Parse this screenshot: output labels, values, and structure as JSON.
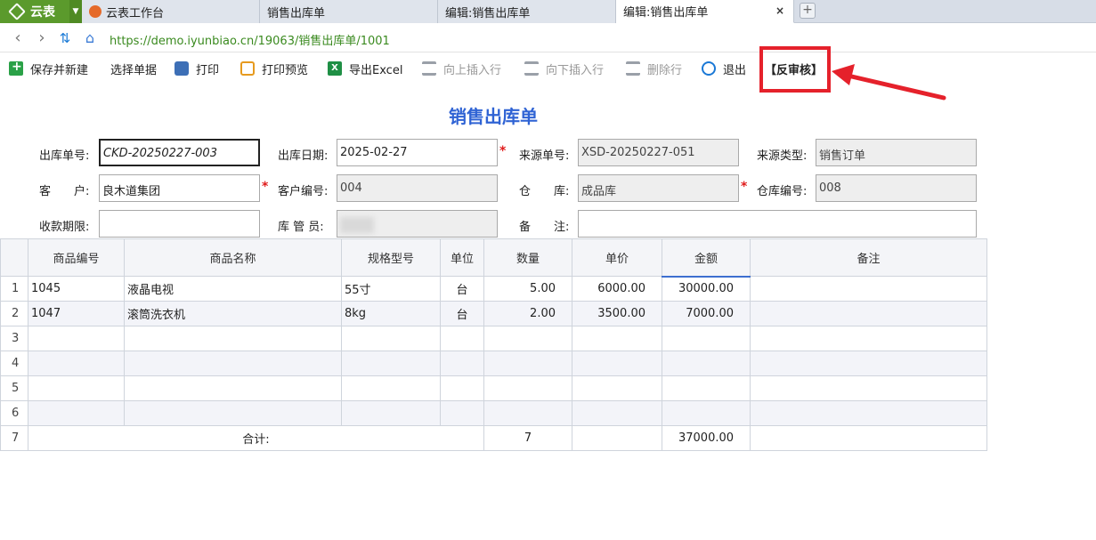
{
  "browser": {
    "app_name": "云表",
    "tabs": [
      {
        "label": "云表工作台"
      },
      {
        "label": "销售出库单"
      },
      {
        "label": "编辑:销售出库单"
      },
      {
        "label": "编辑:销售出库单",
        "close": "×"
      }
    ],
    "new_tab": "+",
    "url": "https://demo.iyunbiao.cn/19063/销售出库单/1001"
  },
  "toolbar": {
    "save_new": "保存并新建",
    "select_doc": "选择单据",
    "print": "打印",
    "print_preview": "打印预览",
    "export_excel": "导出Excel",
    "insert_above": "向上插入行",
    "insert_below": "向下插入行",
    "delete_row": "删除行",
    "exit": "退出",
    "unaudit": "【反审核】"
  },
  "form": {
    "title": "销售出库单",
    "fields": {
      "doc_no_label": "出库单号:",
      "doc_no": "CKD-20250227-003",
      "date_label": "出库日期:",
      "date": "2025-02-27",
      "source_no_label": "来源单号:",
      "source_no": "XSD-20250227-051",
      "source_type_label": "来源类型:",
      "source_type": "销售订单",
      "customer_label": "客　　户:",
      "customer": "良木道集团",
      "customer_no_label": "客户编号:",
      "customer_no": "004",
      "warehouse_label": "仓　　库:",
      "warehouse": "成品库",
      "warehouse_no_label": "仓库编号:",
      "warehouse_no": "008",
      "payment_term_label": "收款期限:",
      "payment_term": "",
      "keeper_label": "库 管 员:",
      "keeper": "",
      "remark_label": "备　　注:",
      "remark": ""
    },
    "required_mark": "*"
  },
  "grid": {
    "headers": [
      "商品编号",
      "商品名称",
      "规格型号",
      "单位",
      "数量",
      "单价",
      "金额",
      "备注"
    ],
    "rows": [
      {
        "no": "1",
        "code": "1045",
        "name": "液晶电视",
        "spec": "55寸",
        "unit": "台",
        "qty": "5.00",
        "price": "6000.00",
        "amount": "30000.00",
        "remark": ""
      },
      {
        "no": "2",
        "code": "1047",
        "name": "滚筒洗衣机",
        "spec": "8kg",
        "unit": "台",
        "qty": "2.00",
        "price": "3500.00",
        "amount": "7000.00",
        "remark": ""
      }
    ],
    "empty_rows": [
      "3",
      "4",
      "5",
      "6"
    ],
    "total": {
      "no": "7",
      "label": "合计:",
      "qty": "7",
      "amount": "37000.00"
    }
  }
}
